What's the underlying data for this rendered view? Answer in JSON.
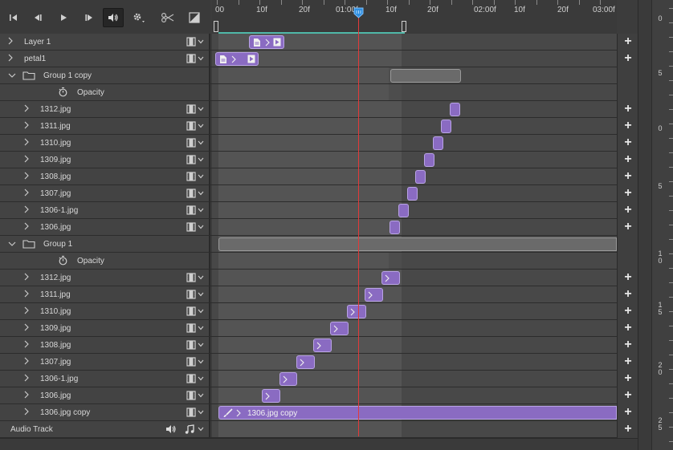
{
  "toolbar": {
    "buttons": [
      {
        "name": "go-to-first-frame-button",
        "icon": "skip-back-icon"
      },
      {
        "name": "previous-frame-button",
        "icon": "step-back-icon"
      },
      {
        "name": "play-button",
        "icon": "play-icon"
      },
      {
        "name": "next-frame-button",
        "icon": "step-forward-icon"
      },
      {
        "name": "mute-audio-button",
        "icon": "speaker-icon"
      },
      {
        "name": "settings-button",
        "icon": "gear-icon"
      },
      {
        "name": "split-at-playhead-button",
        "icon": "scissors-icon"
      },
      {
        "name": "transition-button",
        "icon": "transition-icon"
      }
    ]
  },
  "ruler": {
    "labels": [
      "00",
      "10f",
      "20f",
      "01:00f",
      "10f",
      "20f",
      "02:00f",
      "10f",
      "20f",
      "03:00f"
    ]
  },
  "tracks": [
    {
      "label": "Layer 1",
      "kind": "layer",
      "level": 0
    },
    {
      "label": "petal1",
      "kind": "layer",
      "level": 0
    },
    {
      "label": "Group 1 copy",
      "kind": "group",
      "level": 0
    },
    {
      "label": "Opacity",
      "kind": "property",
      "level": 1
    },
    {
      "label": "1312.jpg",
      "kind": "layer",
      "level": 1
    },
    {
      "label": "1311.jpg",
      "kind": "layer",
      "level": 1
    },
    {
      "label": "1310.jpg",
      "kind": "layer",
      "level": 1
    },
    {
      "label": "1309.jpg",
      "kind": "layer",
      "level": 1
    },
    {
      "label": "1308.jpg",
      "kind": "layer",
      "level": 1
    },
    {
      "label": "1307.jpg",
      "kind": "layer",
      "level": 1
    },
    {
      "label": "1306-1.jpg",
      "kind": "layer",
      "level": 1
    },
    {
      "label": "1306.jpg",
      "kind": "layer",
      "level": 1
    },
    {
      "label": "Group 1",
      "kind": "group",
      "level": 0
    },
    {
      "label": "Opacity",
      "kind": "property",
      "level": 1
    },
    {
      "label": "1312.jpg",
      "kind": "layer",
      "level": 1
    },
    {
      "label": "1311.jpg",
      "kind": "layer",
      "level": 1
    },
    {
      "label": "1310.jpg",
      "kind": "layer",
      "level": 1
    },
    {
      "label": "1309.jpg",
      "kind": "layer",
      "level": 1
    },
    {
      "label": "1308.jpg",
      "kind": "layer",
      "level": 1
    },
    {
      "label": "1307.jpg",
      "kind": "layer",
      "level": 1
    },
    {
      "label": "1306-1.jpg",
      "kind": "layer",
      "level": 1
    },
    {
      "label": "1306.jpg",
      "kind": "layer",
      "level": 1
    },
    {
      "label": "1306.jpg copy",
      "kind": "layer",
      "level": 1
    },
    {
      "label": "Audio Track",
      "kind": "audio",
      "level": 0
    }
  ],
  "clip_label": "1306.jpg copy",
  "side_ruler": {
    "labels": [
      "0",
      "5",
      "0",
      "5",
      "1\n0",
      "1\n5",
      "2\n0",
      "2\n5"
    ]
  },
  "colors": {
    "clip": "#8a6bc2",
    "clip_border": "#b9a3e6",
    "playhead": "#e23a3a",
    "work_area": "#4fb8a8"
  }
}
